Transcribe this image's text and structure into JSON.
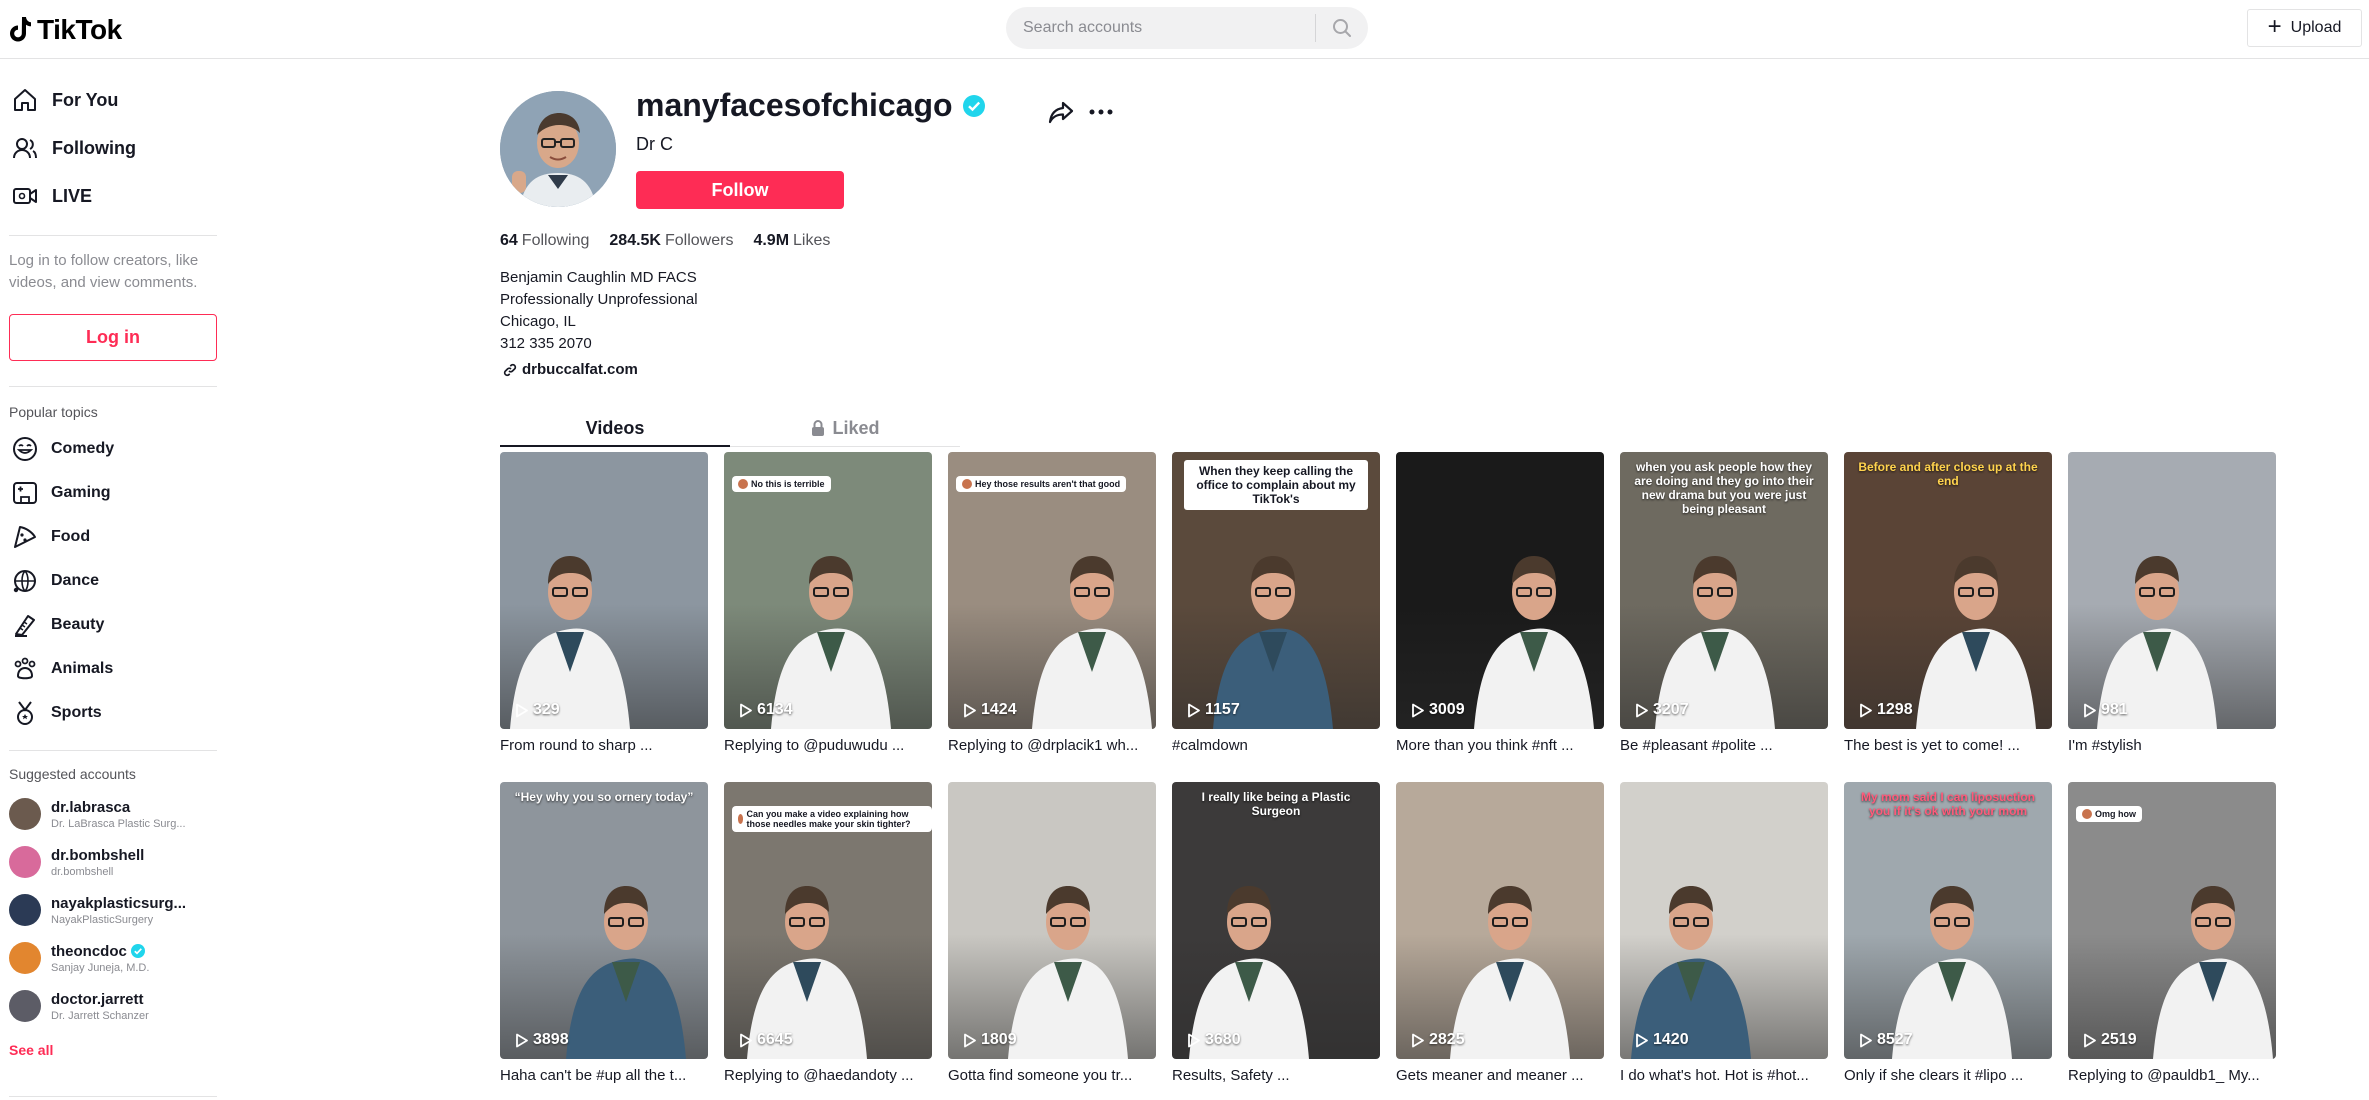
{
  "header": {
    "logo_text": "TikTok",
    "search_placeholder": "Search accounts",
    "upload_label": "Upload"
  },
  "sidebar": {
    "nav": [
      {
        "label": "For You",
        "icon": "home-icon"
      },
      {
        "label": "Following",
        "icon": "following-icon"
      },
      {
        "label": "LIVE",
        "icon": "live-icon"
      }
    ],
    "login_hint": "Log in to follow creators, like videos, and view comments.",
    "login_label": "Log in",
    "topics_title": "Popular topics",
    "topics": [
      {
        "label": "Comedy",
        "icon": "comedy-icon"
      },
      {
        "label": "Gaming",
        "icon": "gaming-icon"
      },
      {
        "label": "Food",
        "icon": "food-icon"
      },
      {
        "label": "Dance",
        "icon": "dance-icon"
      },
      {
        "label": "Beauty",
        "icon": "beauty-icon"
      },
      {
        "label": "Animals",
        "icon": "animals-icon"
      },
      {
        "label": "Sports",
        "icon": "sports-icon"
      }
    ],
    "suggested_title": "Suggested accounts",
    "suggested": [
      {
        "name": "dr.labrasca",
        "sub": "Dr. LaBrasca Plastic Surg...",
        "verified": false,
        "color": "#6b5a4e"
      },
      {
        "name": "dr.bombshell",
        "sub": "dr.bombshell",
        "verified": false,
        "color": "#d86a9b"
      },
      {
        "name": "nayakplasticsurg...",
        "sub": "NayakPlasticSurgery",
        "verified": false,
        "color": "#2b3a55"
      },
      {
        "name": "theoncdoc",
        "sub": "Sanjay Juneja, M.D.",
        "verified": true,
        "color": "#e2862f"
      },
      {
        "name": "doctor.jarrett",
        "sub": "Dr. Jarrett Schanzer",
        "verified": false,
        "color": "#5c5c66"
      }
    ],
    "see_all": "See all"
  },
  "profile": {
    "username": "manyfacesofchicago",
    "display_name": "Dr C",
    "follow_label": "Follow",
    "stats": [
      {
        "value": "64",
        "label": "Following"
      },
      {
        "value": "284.5K",
        "label": "Followers"
      },
      {
        "value": "4.9M",
        "label": "Likes"
      }
    ],
    "bio": [
      "Benjamin Caughlin MD FACS",
      "Professionally Unprofessional",
      "Chicago, IL",
      "312 335 2070"
    ],
    "link": "drbuccalfat.com"
  },
  "tabs": {
    "videos": "Videos",
    "liked": "Liked"
  },
  "videos": [
    {
      "views": "329",
      "caption": "From round to sharp ...",
      "bg": "#8c96a0",
      "overlay": ""
    },
    {
      "views": "6134",
      "caption": "Replying to @puduwudu ...",
      "bg": "#7d8a7a",
      "overlay": "",
      "reply": "No this is terrible"
    },
    {
      "views": "1424",
      "caption": "Replying to @drplacik1 wh...",
      "bg": "#9a8d80",
      "overlay": "",
      "reply": "Hey those results aren't that good"
    },
    {
      "views": "1157",
      "caption": "#calmdown",
      "bg": "#5b4a3c",
      "overlay": "When they keep calling the office to complain about my TikTok's"
    },
    {
      "views": "3009",
      "caption": "More than you think #nft ...",
      "bg": "#1a1a1a",
      "overlay": ""
    },
    {
      "views": "3207",
      "caption": "Be #pleasant #polite ...",
      "bg": "#6e6a60",
      "overlay": "when you ask people how they are doing and they go into their new drama but you were just being pleasant"
    },
    {
      "views": "1298",
      "caption": "The best is yet to come! ...",
      "bg": "#5a4436",
      "overlay": "Before and after close up at the end"
    },
    {
      "views": "981",
      "caption": "I'm #stylish",
      "bg": "#a6abb2",
      "overlay": ""
    },
    {
      "views": "3898",
      "caption": "Haha can't be #up all the t...",
      "bg": "#8e959c",
      "overlay": "“Hey why you so ornery today”"
    },
    {
      "views": "6645",
      "caption": "Replying to @haedandoty ...",
      "bg": "#7c776f",
      "overlay": "",
      "reply": "Can you make a video explaining how those needles make your skin tighter?"
    },
    {
      "views": "1809",
      "caption": "Gotta find someone you tr...",
      "bg": "#c9c7c2",
      "overlay": ""
    },
    {
      "views": "3680",
      "caption": "Results, Safety ...",
      "bg": "#3c3a3a",
      "overlay": "I really like being a Plastic Surgeon"
    },
    {
      "views": "2825",
      "caption": "Gets meaner and meaner ...",
      "bg": "#b7a99a",
      "overlay": ""
    },
    {
      "views": "1420",
      "caption": "I do what's hot. Hot is #hot...",
      "bg": "#d2d0cb",
      "overlay": ""
    },
    {
      "views": "8527",
      "caption": "Only if she clears it #lipo ...",
      "bg": "#9fa8ae",
      "overlay": "My mom said I can liposuction you if it's ok with your mom"
    },
    {
      "views": "2519",
      "caption": "Replying to @pauldb1_ My...",
      "bg": "#8b8b8b",
      "overlay": "",
      "reply": "Omg how"
    }
  ],
  "colors": {
    "brand": "#fe2c55",
    "verified": "#20d5ec",
    "text": "#161823",
    "muted": "#8a8b91"
  }
}
